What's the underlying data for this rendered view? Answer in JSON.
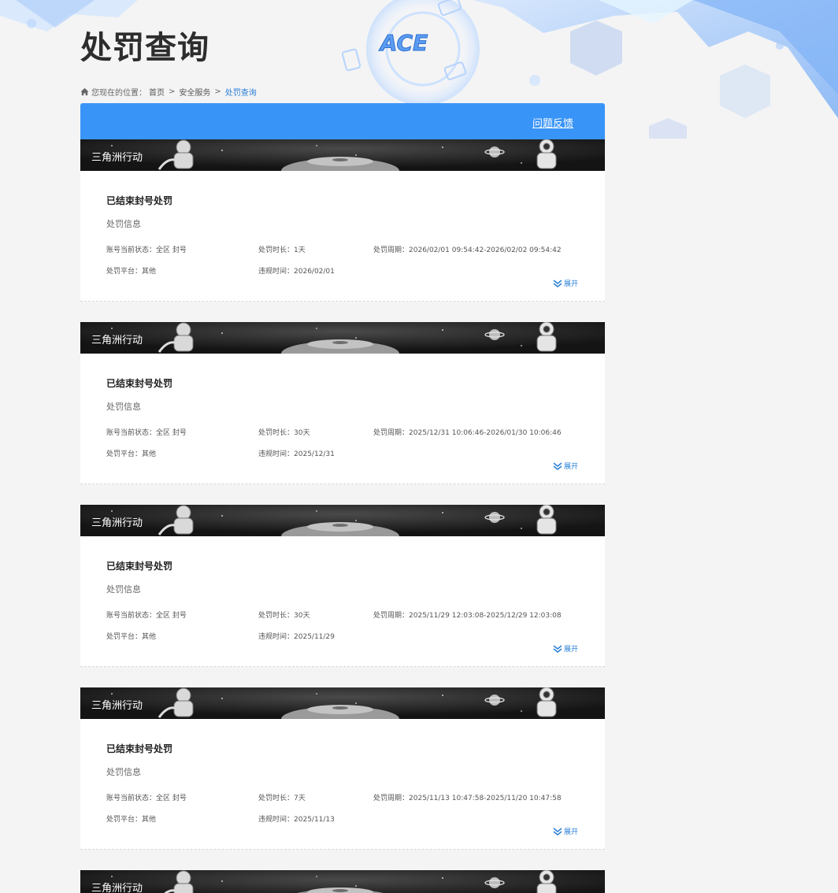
{
  "page": {
    "title": "处罚查询"
  },
  "breadcrumb": {
    "prefix": "您现在的位置：",
    "home": "首页",
    "section": "安全服务",
    "current": "处罚查询",
    "separator": ">"
  },
  "panel": {
    "feedback_label": "问题反馈"
  },
  "labels": {
    "status": "账号当前状态：",
    "duration": "处罚时长：",
    "period": "处罚周期：",
    "platform": "处罚平台：",
    "violation_time": "违规时间：",
    "expand": "展开"
  },
  "records": [
    {
      "game": "三角洲行动",
      "title": "已结束封号处罚",
      "subtitle": "处罚信息",
      "status": "全区 封号",
      "duration": "1天",
      "period": "2026/02/01 09:54:42-2026/02/02 09:54:42",
      "platform": "其他",
      "violation_time": "2026/02/01"
    },
    {
      "game": "三角洲行动",
      "title": "已结束封号处罚",
      "subtitle": "处罚信息",
      "status": "全区 封号",
      "duration": "30天",
      "period": "2025/12/31 10:06:46-2026/01/30 10:06:46",
      "platform": "其他",
      "violation_time": "2025/12/31"
    },
    {
      "game": "三角洲行动",
      "title": "已结束封号处罚",
      "subtitle": "处罚信息",
      "status": "全区 封号",
      "duration": "30天",
      "period": "2025/11/29 12:03:08-2025/12/29 12:03:08",
      "platform": "其他",
      "violation_time": "2025/11/29"
    },
    {
      "game": "三角洲行动",
      "title": "已结束封号处罚",
      "subtitle": "处罚信息",
      "status": "全区 封号",
      "duration": "7天",
      "period": "2025/11/13 10:47:58-2025/11/20 10:47:58",
      "platform": "其他",
      "violation_time": "2025/11/13"
    },
    {
      "game": "三角洲行动"
    }
  ],
  "logo": {
    "text": "ACE"
  },
  "colors": {
    "accent": "#3994f7",
    "link": "#2a7fd6",
    "banner": "#1b1b1b"
  }
}
